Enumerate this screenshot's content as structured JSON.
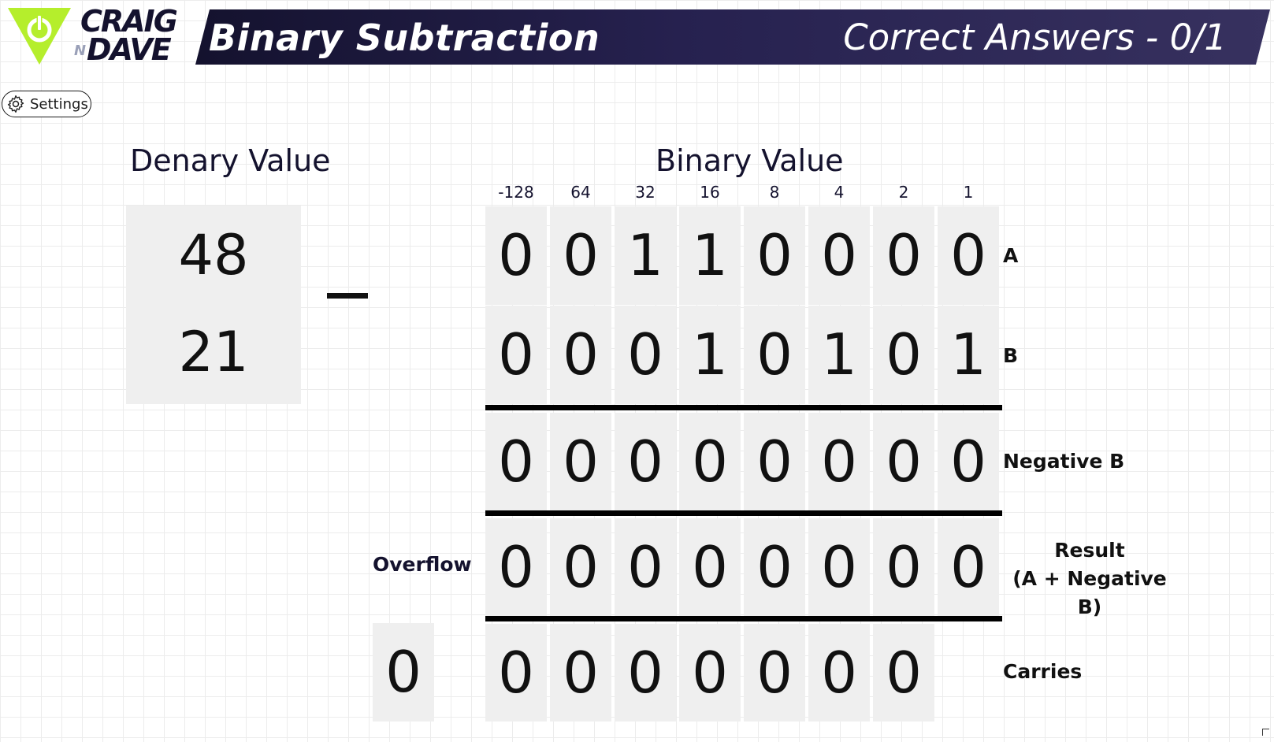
{
  "header": {
    "brand": {
      "line1": "CRAIG",
      "n": "N",
      "line2": "DAVE"
    },
    "title": "Binary Subtraction",
    "score": "Correct Answers - 0/1"
  },
  "settings": {
    "label": "Settings"
  },
  "denary": {
    "heading": "Denary Value",
    "a": "48",
    "b": "21",
    "operator": "minus"
  },
  "binary": {
    "heading": "Binary Value",
    "place_values": [
      "-128",
      "64",
      "32",
      "16",
      "8",
      "4",
      "2",
      "1"
    ],
    "rows": [
      {
        "label": "A",
        "bits": [
          "0",
          "0",
          "1",
          "1",
          "0",
          "0",
          "0",
          "0"
        ]
      },
      {
        "label": "B",
        "bits": [
          "0",
          "0",
          "0",
          "1",
          "0",
          "1",
          "0",
          "1"
        ]
      },
      {
        "label": "Negative B",
        "bits": [
          "0",
          "0",
          "0",
          "0",
          "0",
          "0",
          "0",
          "0"
        ]
      },
      {
        "label_line1": "Result",
        "label_line2": "(A + Negative B)",
        "bits": [
          "0",
          "0",
          "0",
          "0",
          "0",
          "0",
          "0",
          "0"
        ]
      },
      {
        "label": "Carries",
        "bits": [
          "0",
          "0",
          "0",
          "0",
          "0",
          "0",
          "0"
        ]
      }
    ],
    "overflow": {
      "label": "Overflow",
      "value": "0"
    }
  },
  "colors": {
    "header_start": "#14122e",
    "header_end": "#37315f",
    "logo_green": "#b5ee2c",
    "cell_bg": "#efefef",
    "text_dark": "#14122e"
  }
}
